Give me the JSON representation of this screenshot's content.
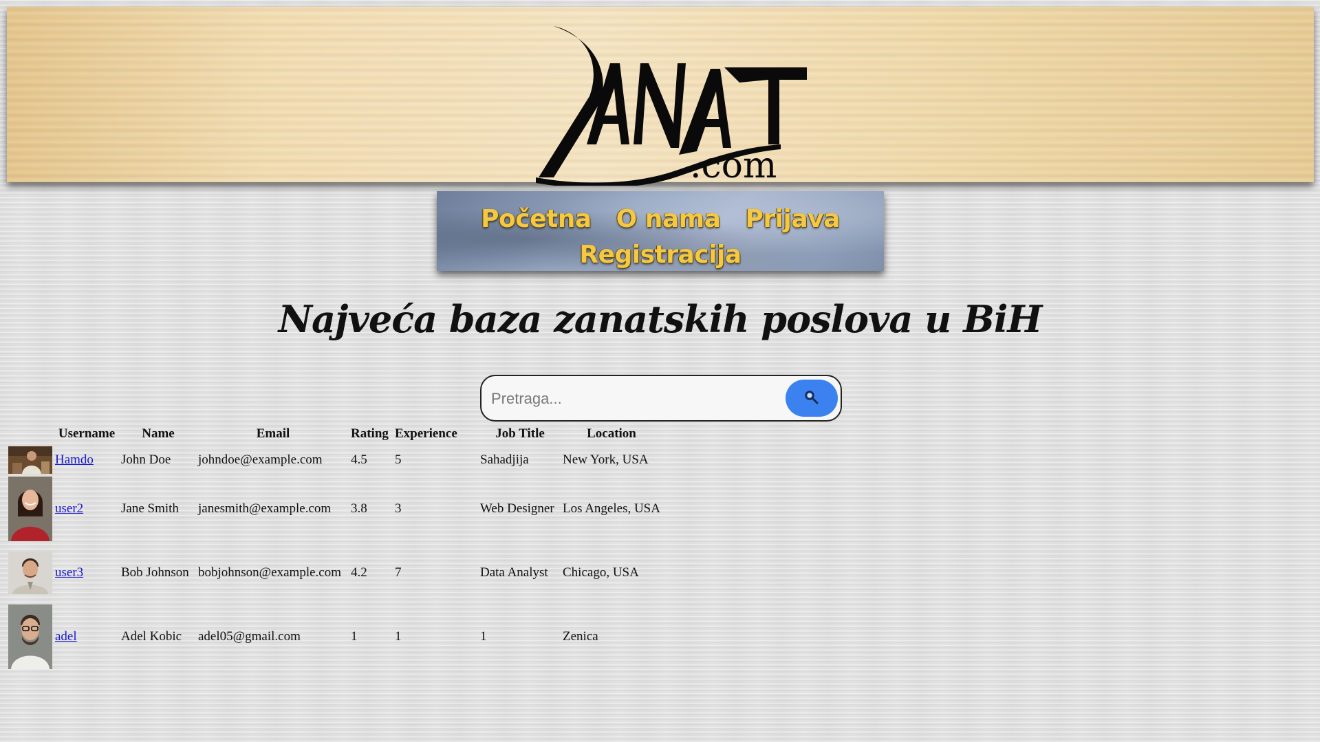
{
  "header": {
    "logo_text": "ZANAT",
    "logo_suffix": ".com"
  },
  "nav": {
    "items": [
      "Početna",
      "O nama",
      "Prijava",
      "Registracija"
    ]
  },
  "headline": "Najveća baza zanatskih poslova u BiH",
  "search": {
    "placeholder": "Pretraga...",
    "value": "",
    "button_icon": "search-icon"
  },
  "table": {
    "headers": [
      "Username",
      "Name",
      "Email",
      "Rating",
      "Experience",
      "Job Title",
      "Location"
    ],
    "rows": [
      {
        "avatar": "craftsman-photo",
        "username": "Hamdo",
        "name": "John Doe",
        "email": "johndoe@example.com",
        "rating": "4.5",
        "experience": "5",
        "job_title": "Sahadjija",
        "location": "New York, USA"
      },
      {
        "avatar": "woman-portrait",
        "username": "user2",
        "name": "Jane Smith",
        "email": "janesmith@example.com",
        "rating": "3.8",
        "experience": "3",
        "job_title": "Web Designer",
        "location": "Los Angeles, USA"
      },
      {
        "avatar": "man-portrait",
        "username": "user3",
        "name": "Bob Johnson",
        "email": "bobjohnson@example.com",
        "rating": "4.2",
        "experience": "7",
        "job_title": "Data Analyst",
        "location": "Chicago, USA"
      },
      {
        "avatar": "man-glasses-portrait",
        "username": "adel",
        "name": "Adel Kobic",
        "email": "adel05@gmail.com",
        "rating": "1",
        "experience": "1",
        "job_title": "1",
        "location": "Zenica"
      }
    ]
  },
  "colors": {
    "nav_text": "#f5c842",
    "search_button": "#3b82f0",
    "link": "#1a1acc"
  }
}
